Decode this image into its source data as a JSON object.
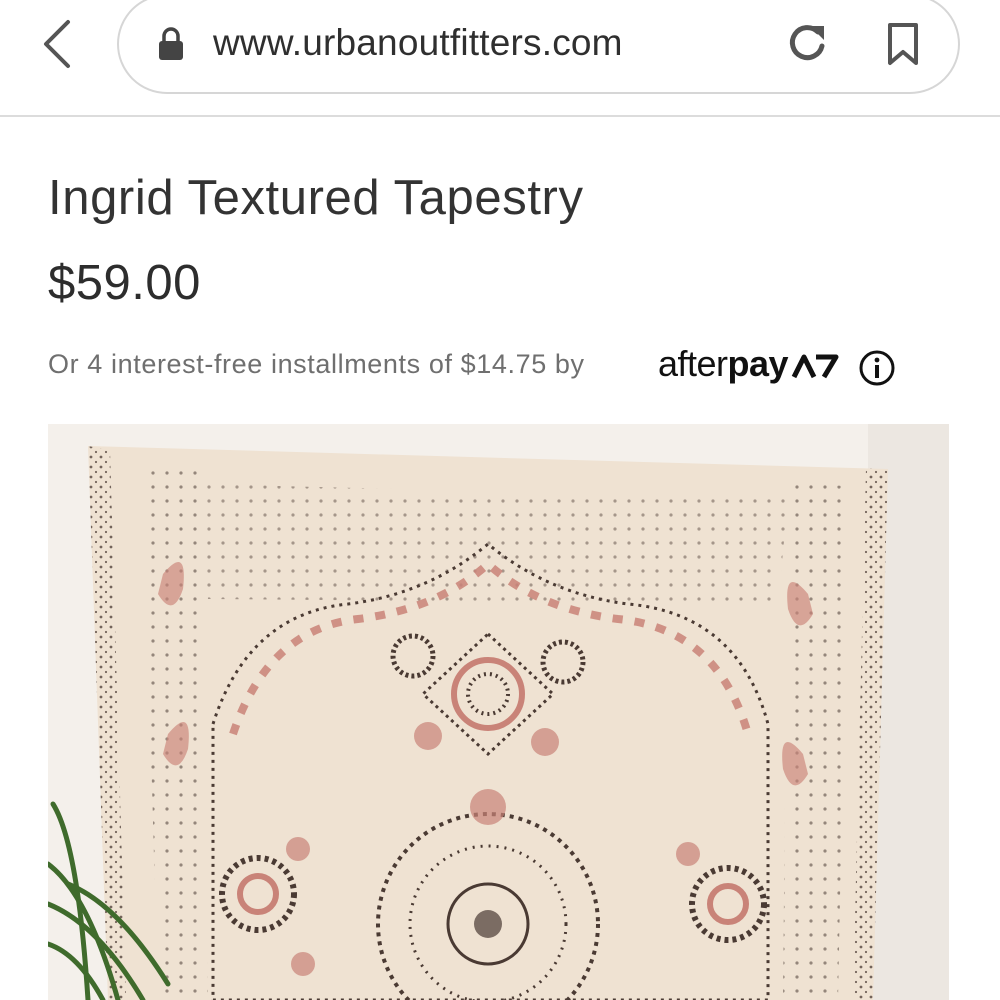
{
  "browser": {
    "url": "www.urbanoutfitters.com"
  },
  "product": {
    "title": "Ingrid Textured Tapestry",
    "price": "$59.00",
    "installments_text": "Or 4 interest-free installments of $14.75 by",
    "afterpay_logo_light": "after",
    "afterpay_logo_bold": "pay",
    "image_alt": "tapestry-photo"
  },
  "colors": {
    "tapestry_base": "#efe2d2",
    "tapestry_dark": "#4a3a33",
    "tapestry_rose": "#c98378",
    "wall": "#f4f0eb",
    "plant": "#3f6b2c"
  }
}
